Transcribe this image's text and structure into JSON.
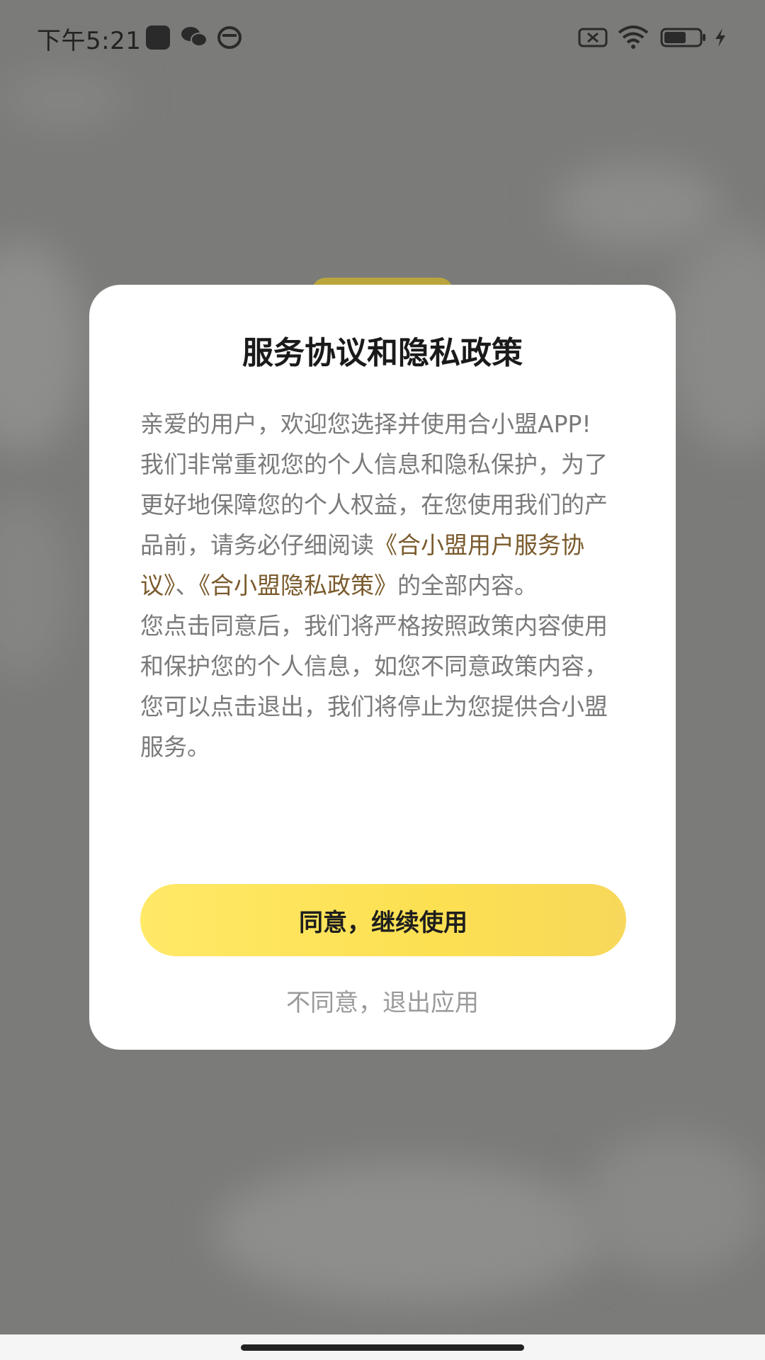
{
  "status_bar": {
    "time": "下午5:21",
    "battery_level": "57",
    "icons": [
      "notification-square-icon",
      "wechat-icon",
      "shield-icon",
      "sim-disabled-icon",
      "wifi-icon",
      "battery-icon",
      "charging-bolt-icon"
    ]
  },
  "dialog": {
    "title": "服务协议和隐私政策",
    "intro": "亲爱的用户，欢迎您选择并使用合小盟APP!",
    "para2_prefix": "我们非常重视您的个人信息和隐私保护，为了更好地保障您的个人权益，在您使用我们的产品前，请务必仔细阅读",
    "link_user_agreement": "《合小盟用户服务协议》",
    "separator": "、",
    "link_privacy_policy": "《合小盟隐私政策》",
    "para2_suffix": "的全部内容。",
    "para3": "您点击同意后，我们将严格按照政策内容使用和保护您的个人信息，如您不同意政策内容，您可以点击退出，我们将停止为您提供合小盟服务。",
    "agree_label": "同意，继续使用",
    "decline_label": "不同意，退出应用"
  },
  "colors": {
    "agree_button": "#fce052",
    "link": "#7a5a2c",
    "overlay": "#7b7b79"
  }
}
